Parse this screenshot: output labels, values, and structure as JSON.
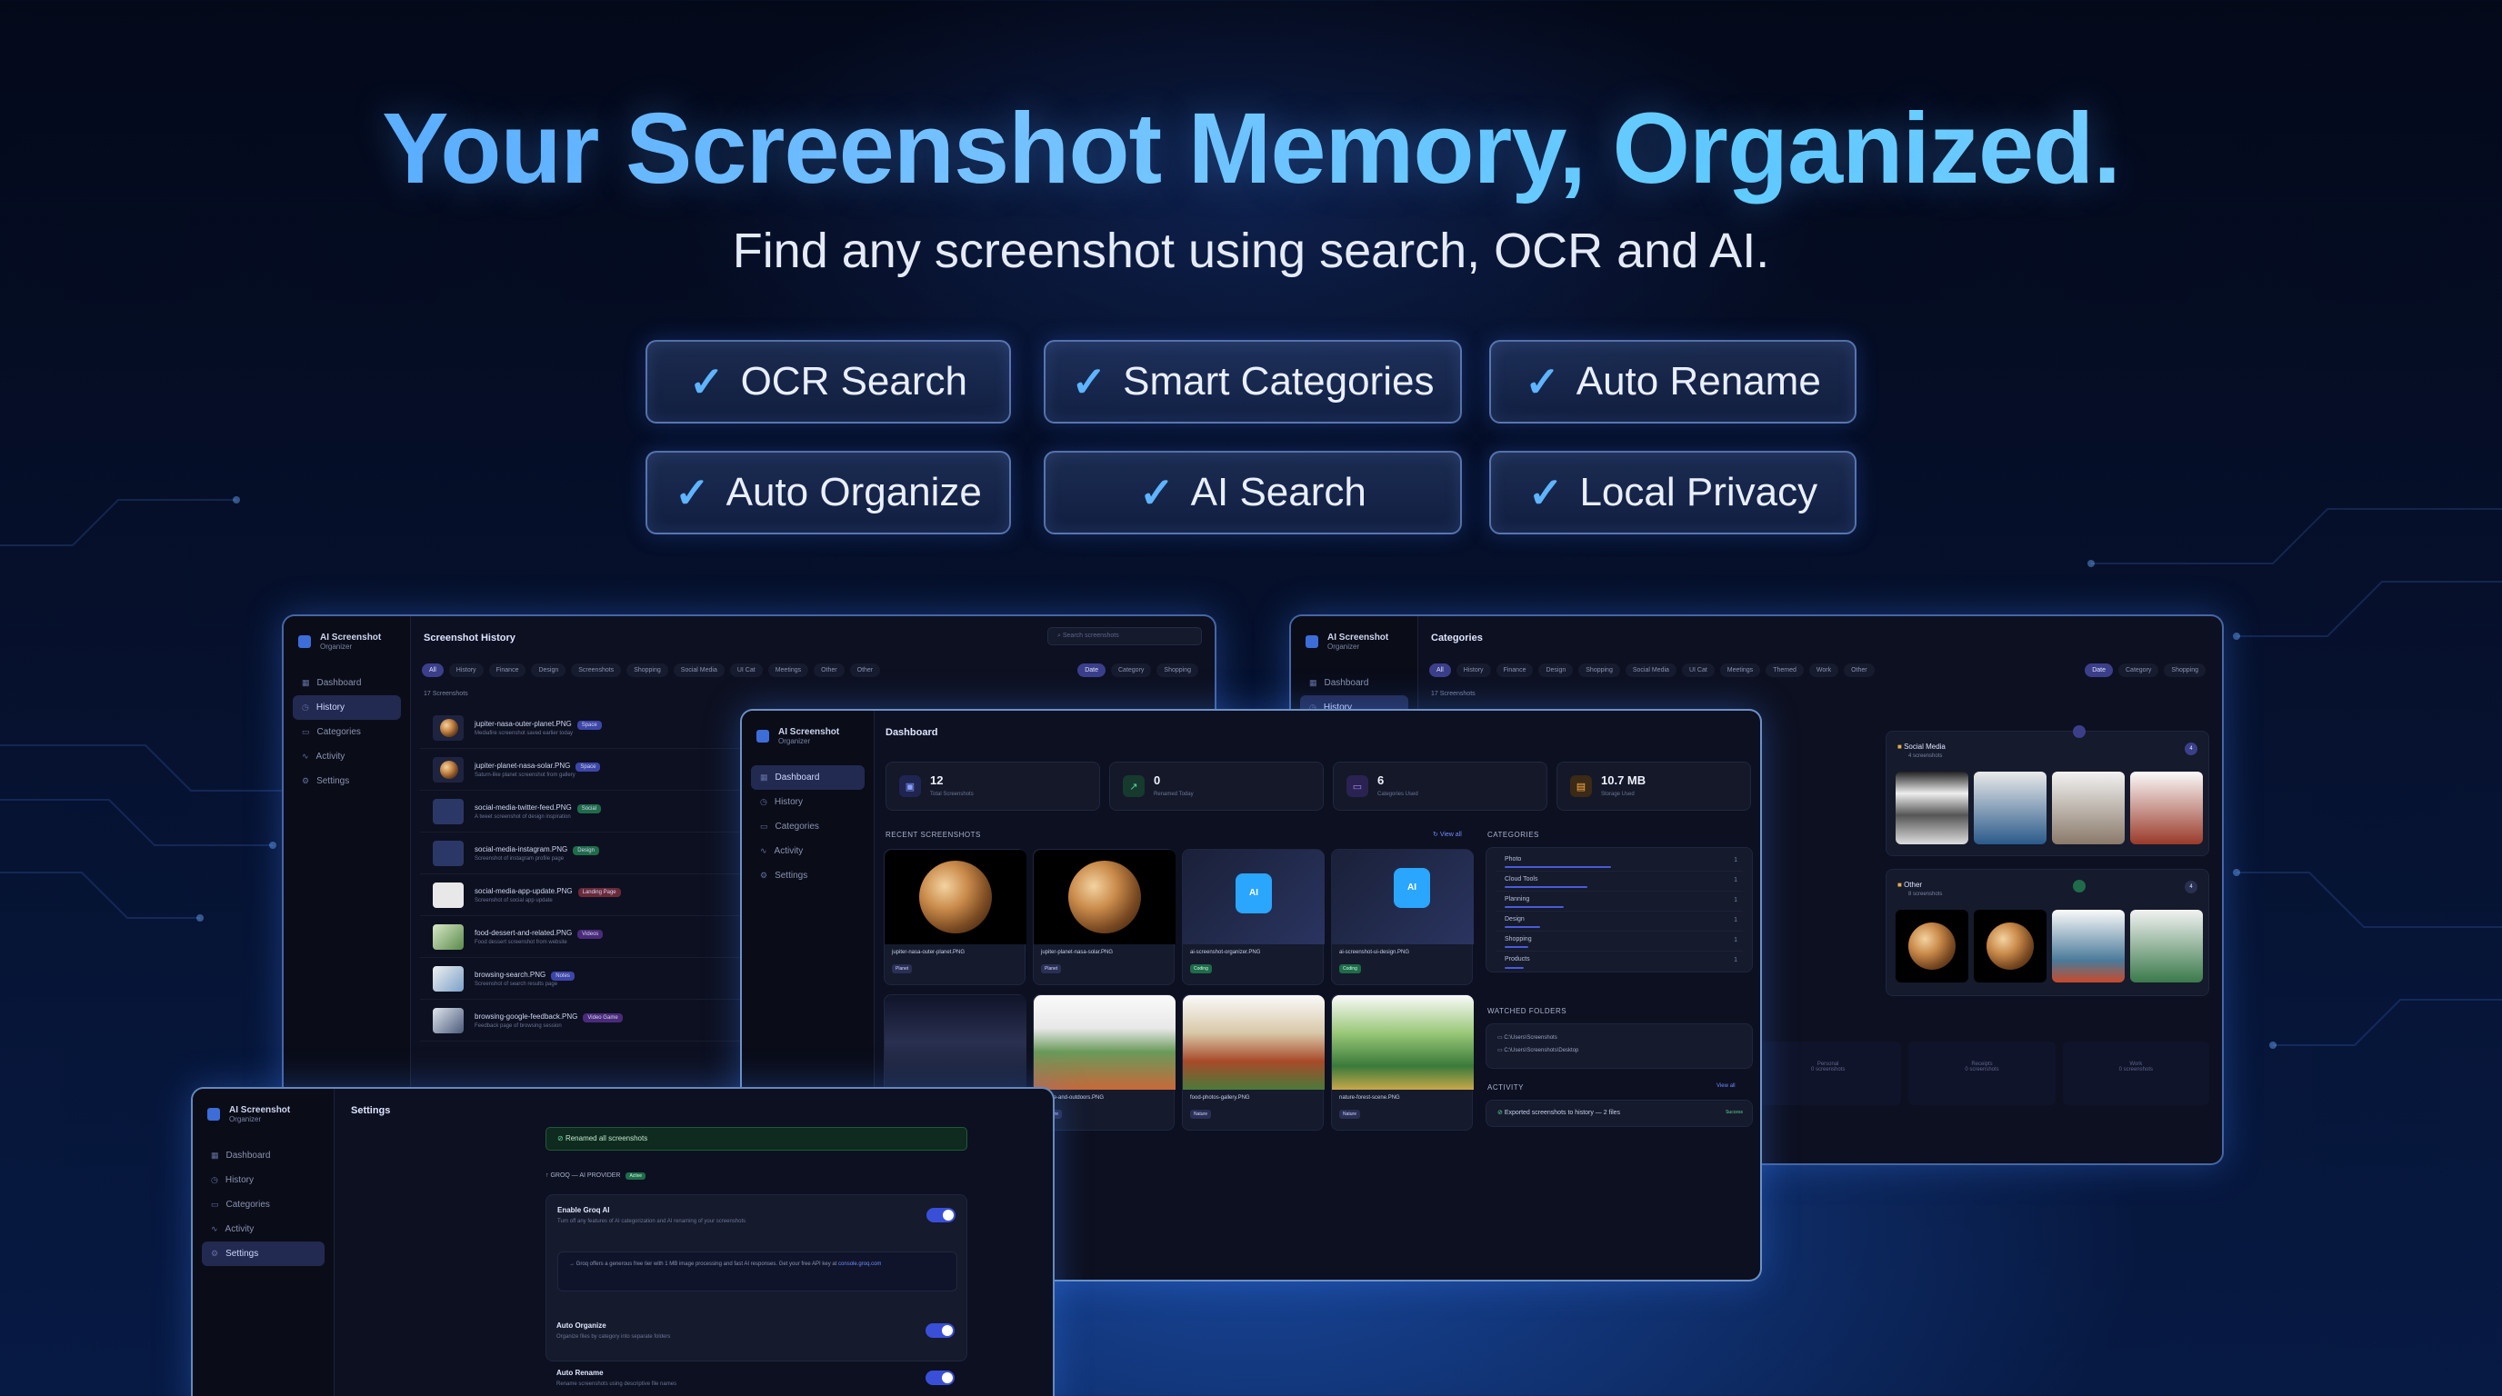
{
  "hero": {
    "title": "Your Screenshot Memory, Organized.",
    "subtitle": "Find any screenshot using search, OCR and AI."
  },
  "features": [
    {
      "label": "OCR Search"
    },
    {
      "label": "Smart Categories"
    },
    {
      "label": "Auto Rename"
    },
    {
      "label": "Auto Organize"
    },
    {
      "label": "AI Search"
    },
    {
      "label": "Local Privacy"
    }
  ],
  "colors": {
    "accent": "#5fb4ff",
    "nav_active": "#222a52",
    "toggle": "#3a4fd8"
  },
  "app": {
    "name": "AI Screenshot",
    "tagline": "Organizer"
  },
  "nav": [
    "Dashboard",
    "History",
    "Categories",
    "Activity",
    "Settings"
  ],
  "history_window": {
    "title": "Screenshot History",
    "search_placeholder": "Search screenshots",
    "count_text": "17 Screenshots",
    "filters": [
      "All",
      "History",
      "Finance",
      "Design",
      "Screenshots",
      "Shopping",
      "Social Media",
      "UI Cat",
      "Meetings",
      "Other",
      "Other"
    ],
    "sort_labels": [
      "Date",
      "Category",
      "Shopping"
    ],
    "rows": [
      {
        "name": "jupiter-nasa-outer-planet.PNG",
        "tag": "Space",
        "tag_color": "#3d46a8",
        "meta": "Mediafire screenshot saved earlier today"
      },
      {
        "name": "jupiter-planet-nasa-solar.PNG",
        "tag": "Space",
        "tag_color": "#3d46a8",
        "meta": "Saturn-like planet screenshot from gallery"
      },
      {
        "name": "social-media-twitter-feed.PNG",
        "tag": "Social",
        "tag_color": "#1f6b4a",
        "meta": "A tweet screenshot of design inspiration"
      },
      {
        "name": "social-media-instagram.PNG",
        "tag": "Design",
        "tag_color": "#1f6b4a",
        "meta": "Screenshot of instagram profile page"
      },
      {
        "name": "social-media-app-update.PNG",
        "tag": "Landing Page",
        "tag_color": "#6b2a3a",
        "meta": "Screenshot of social app update"
      },
      {
        "name": "food-dessert-and-related.PNG",
        "tag": "Videos",
        "tag_color": "#4a2a7a",
        "meta": "Food dessert screenshot from website"
      },
      {
        "name": "browsing-search.PNG",
        "tag": "Notes",
        "tag_color": "#3d46a8",
        "meta": "Screenshot of search results page"
      },
      {
        "name": "browsing-google-feedback.PNG",
        "tag": "Video Game",
        "tag_color": "#4a2a7a",
        "meta": "Feedback page of browsing session"
      }
    ]
  },
  "categories_window": {
    "title": "Categories",
    "filters": [
      "All",
      "History",
      "Finance",
      "Design",
      "Shopping",
      "Social Media",
      "UI Cat",
      "Meetings",
      "Themed",
      "Work",
      "Other"
    ],
    "sort_labels": [
      "Date",
      "Category",
      "Shopping"
    ],
    "count_text": "17 Screenshots",
    "cards": [
      {
        "name": "Social Media",
        "count": "4 screenshots",
        "badge": "4"
      },
      {
        "name": "Other",
        "count": "8 screenshots",
        "badge": "4"
      }
    ],
    "bottom": [
      "Personal",
      "Receipts",
      "Work"
    ],
    "bottom_counts": [
      "0 screenshots",
      "0 screenshots",
      "0 screenshots"
    ]
  },
  "dashboard_window": {
    "title": "Dashboard",
    "stats": [
      {
        "value": "12",
        "label": "Total Screenshots",
        "icon": "images-icon"
      },
      {
        "value": "0",
        "label": "Renamed Today",
        "icon": "trend-icon"
      },
      {
        "value": "6",
        "label": "Categories Used",
        "icon": "folder-icon"
      },
      {
        "value": "10.7 MB",
        "label": "Storage Used",
        "icon": "storage-icon"
      }
    ],
    "recent_label": "RECENT SCREENSHOTS",
    "view_all": "View all",
    "recent": [
      {
        "name": "jupiter-nasa-outer-planet.PNG",
        "tag": "Planet"
      },
      {
        "name": "jupiter-planet-nasa-solar.PNG",
        "tag": "Planet"
      },
      {
        "name": "ai-screenshot-organizer.PNG",
        "tag": "Coding"
      },
      {
        "name": "ai-screenshot-ui-design.PNG",
        "tag": "Coding"
      },
      {
        "name": "",
        "tag": ""
      },
      {
        "name": "nature-and-outdoors.PNG",
        "tag": "Nature"
      },
      {
        "name": "food-photos-gallery.PNG",
        "tag": "Nature"
      },
      {
        "name": "nature-forest-scene.PNG",
        "tag": "Nature"
      }
    ],
    "categories_label": "CATEGORIES",
    "categories": [
      {
        "name": "Photo",
        "count": "1",
        "fill": 0.45
      },
      {
        "name": "Cloud Tools",
        "count": "1",
        "fill": 0.35
      },
      {
        "name": "Planning",
        "count": "1",
        "fill": 0.25
      },
      {
        "name": "Design",
        "count": "1",
        "fill": 0.15
      },
      {
        "name": "Shopping",
        "count": "1",
        "fill": 0.1
      },
      {
        "name": "Products",
        "count": "1",
        "fill": 0.08
      }
    ],
    "watched_label": "WATCHED FOLDERS",
    "watched": [
      "C:\\Users\\Screenshots",
      "C:\\Users\\Screenshots\\Desktop"
    ],
    "activity_label": "ACTIVITY",
    "activity_view_all": "View all",
    "activity_item": "Exported screenshots to history — 2 files",
    "activity_status": "Success"
  },
  "settings_window": {
    "title": "Settings",
    "success_banner": "Renamed all screenshots",
    "section": "GROQ — AI PROVIDER",
    "section_badge": "Active",
    "items": [
      {
        "title": "Enable Groq AI",
        "desc": "Turn off any features of AI categorization and AI renaming of your screenshots"
      },
      {
        "title": "Auto Organize",
        "desc": "Organize files by category into separate folders"
      },
      {
        "title": "Auto Rename",
        "desc": "Rename screenshots using descriptive file names"
      }
    ],
    "info_note": "Groq offers a generous free tier with 1 MB image processing and fast AI responses. Get your free API key at",
    "info_link": "console.groq.com"
  }
}
